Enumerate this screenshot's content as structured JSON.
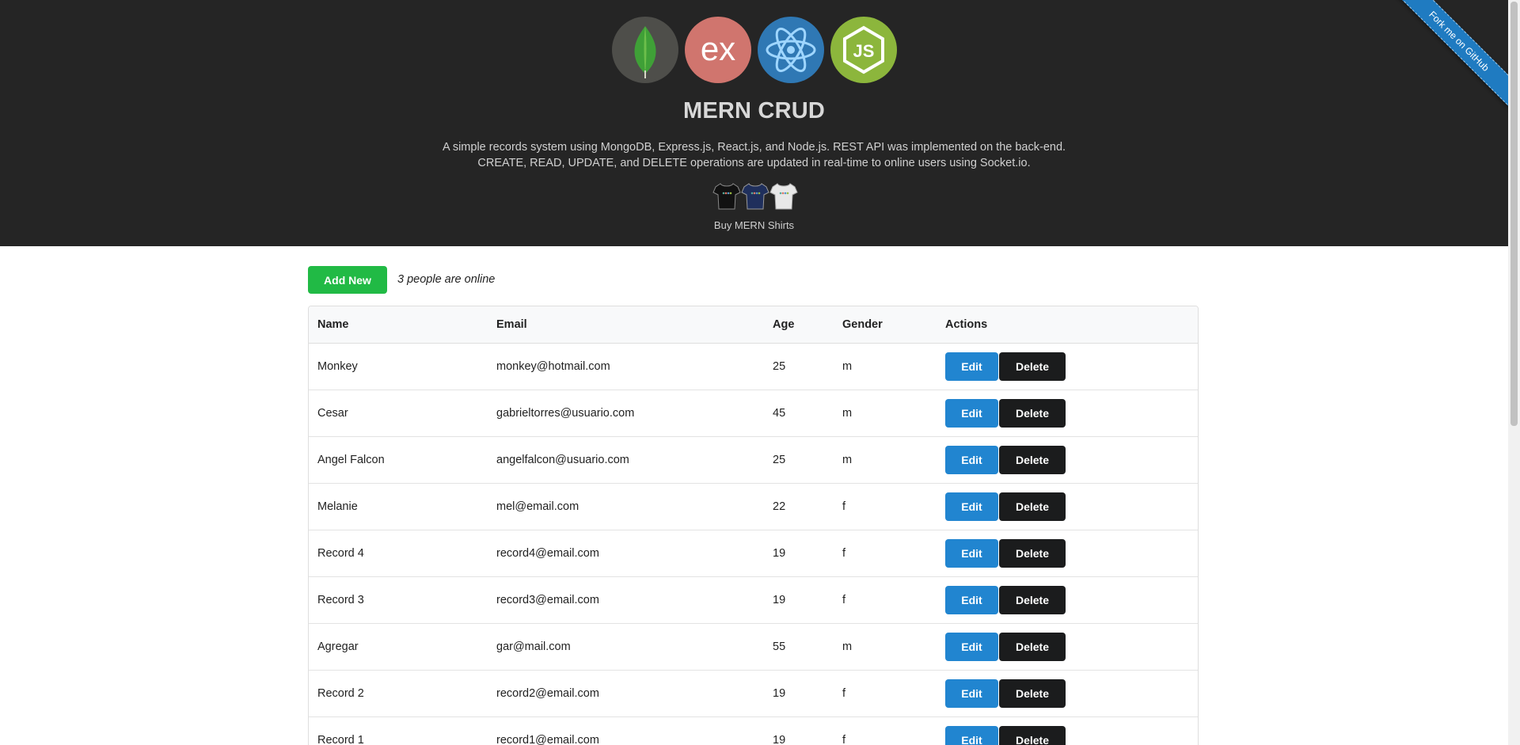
{
  "header": {
    "title": "MERN CRUD",
    "description_line1": "A simple records system using MongoDB, Express.js, React.js, and Node.js. REST API was implemented on the back-end.",
    "description_line2": "CREATE, READ, UPDATE, and DELETE operations are updated in real-time to online users using Socket.io.",
    "shirts_label": "Buy MERN Shirts",
    "ribbon": "Fork me on GitHub",
    "logos": [
      "mongodb-logo",
      "express-logo",
      "react-logo",
      "nodejs-logo"
    ],
    "logo_text_express": "ex",
    "logo_text_node": "JS"
  },
  "toolbar": {
    "add_label": "Add New",
    "online_text": "3 people are online"
  },
  "table": {
    "columns": [
      "Name",
      "Email",
      "Age",
      "Gender",
      "Actions"
    ],
    "edit_label": "Edit",
    "delete_label": "Delete",
    "rows": [
      {
        "name": "Monkey",
        "email": "monkey@hotmail.com",
        "age": "25",
        "gender": "m"
      },
      {
        "name": "Cesar",
        "email": "gabrieltorres@usuario.com",
        "age": "45",
        "gender": "m"
      },
      {
        "name": "Angel Falcon",
        "email": "angelfalcon@usuario.com",
        "age": "25",
        "gender": "m"
      },
      {
        "name": "Melanie",
        "email": "mel@email.com",
        "age": "22",
        "gender": "f"
      },
      {
        "name": "Record 4",
        "email": "record4@email.com",
        "age": "19",
        "gender": "f"
      },
      {
        "name": "Record 3",
        "email": "record3@email.com",
        "age": "19",
        "gender": "f"
      },
      {
        "name": "Agregar",
        "email": "gar@mail.com",
        "age": "55",
        "gender": "m"
      },
      {
        "name": "Record 2",
        "email": "record2@email.com",
        "age": "19",
        "gender": "f"
      },
      {
        "name": "Record 1",
        "email": "record1@email.com",
        "age": "19",
        "gender": "f"
      }
    ]
  },
  "colors": {
    "header_bg": "#252525",
    "add_button": "#21ba45",
    "edit_button": "#2185d0",
    "delete_button": "#1b1c1d",
    "ribbon": "#1f7bc1"
  }
}
